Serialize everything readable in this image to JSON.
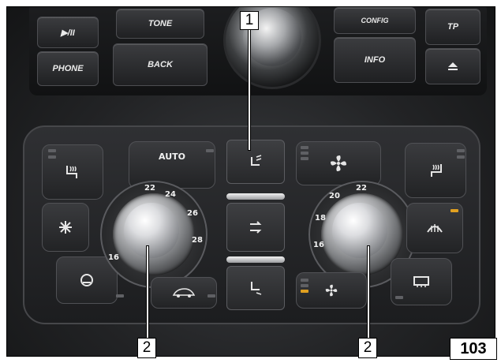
{
  "radio_buttons": {
    "play_pause": "▶/II",
    "phone": "PHONE",
    "tone": "TONE",
    "back": "BACK",
    "config": "CONFIG",
    "info": "INFO",
    "tp": "TP"
  },
  "climate": {
    "auto_label": "AUTO",
    "left_scale": [
      "22",
      "24",
      "26",
      "28",
      "16"
    ],
    "right_scale": [
      "16",
      "18",
      "20",
      "22"
    ]
  },
  "callouts": {
    "num_1": "1",
    "num_2_left": "2",
    "num_2_right": "2"
  },
  "figure_number": "103",
  "colors": {
    "led_active": "#e0a020"
  }
}
